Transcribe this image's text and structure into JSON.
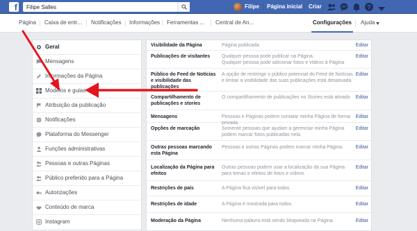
{
  "topbar": {
    "search_value": "Filipe Salles",
    "user_name": "Filipe",
    "links": [
      "Página inicial",
      "Criar"
    ]
  },
  "page_nav": {
    "tabs": [
      "Página",
      "Caixa de entr...",
      "Notificações",
      "Informações",
      "Ferramentas ...",
      "Central de An...",
      "Configurações",
      "Ajuda"
    ]
  },
  "left_menu": {
    "items": [
      "Geral",
      "Mensagens",
      "Informações da Página",
      "Modelos e guias",
      "Atribuição da publicação",
      "Notificações",
      "Plataforma do Messenger",
      "Funções administrativas",
      "Pessoas e outras Páginas",
      "Público preferido para a Página",
      "Autorizações",
      "Conteúdo de marca",
      "Instagram"
    ]
  },
  "settings": {
    "edit_label": "Editar",
    "rows": [
      {
        "label": "Visibilidade da Página",
        "value": "Página publicada"
      },
      {
        "label": "Publicações de visitantes",
        "value": "Qualquer pessoa pode publicar na Página.\nQualquer pessoa pode adicionar fotos e vídeos à Página"
      },
      {
        "label": "Público do Feed de Notícias e visibilidade das publicações",
        "value": "A opção de restringir o público potencial do Feed de Notícias e limitar a visibilidade das suas publicações está desativada"
      },
      {
        "label": "Compartilhamento de publicações e stories",
        "value": "O compartilhamento de publicações no Stories está ativado"
      },
      {
        "label": "Mensagens",
        "value": "Pessoas e Páginas podem contatar minha Página de forma privada."
      },
      {
        "label": "Opções de marcação",
        "value": "Somente pessoas que ajudam a gerenciar minha Página podem marcar fotos publicadas nela."
      },
      {
        "label": "Outras pessoas marcando esta Página",
        "value": "Pessoas e outras Páginas podem marcar minha Página."
      },
      {
        "label": "Localização da Página para efeitos",
        "value": "Outras pessoas podem usar a localização da sua Página para temas e efeitos de fotos e vídeos"
      },
      {
        "label": "Restrições de país",
        "value": "A Página fica visível para todos."
      },
      {
        "label": "Restrições de idade",
        "value": "A Página é mostrada para todos."
      },
      {
        "label": "Moderação da Página",
        "value": "Nenhuma palavra está sendo bloqueada na Página."
      }
    ]
  },
  "colors": {
    "brand_blue": "#4267b2",
    "link_blue": "#385898",
    "annotation_red": "#e4151f"
  }
}
